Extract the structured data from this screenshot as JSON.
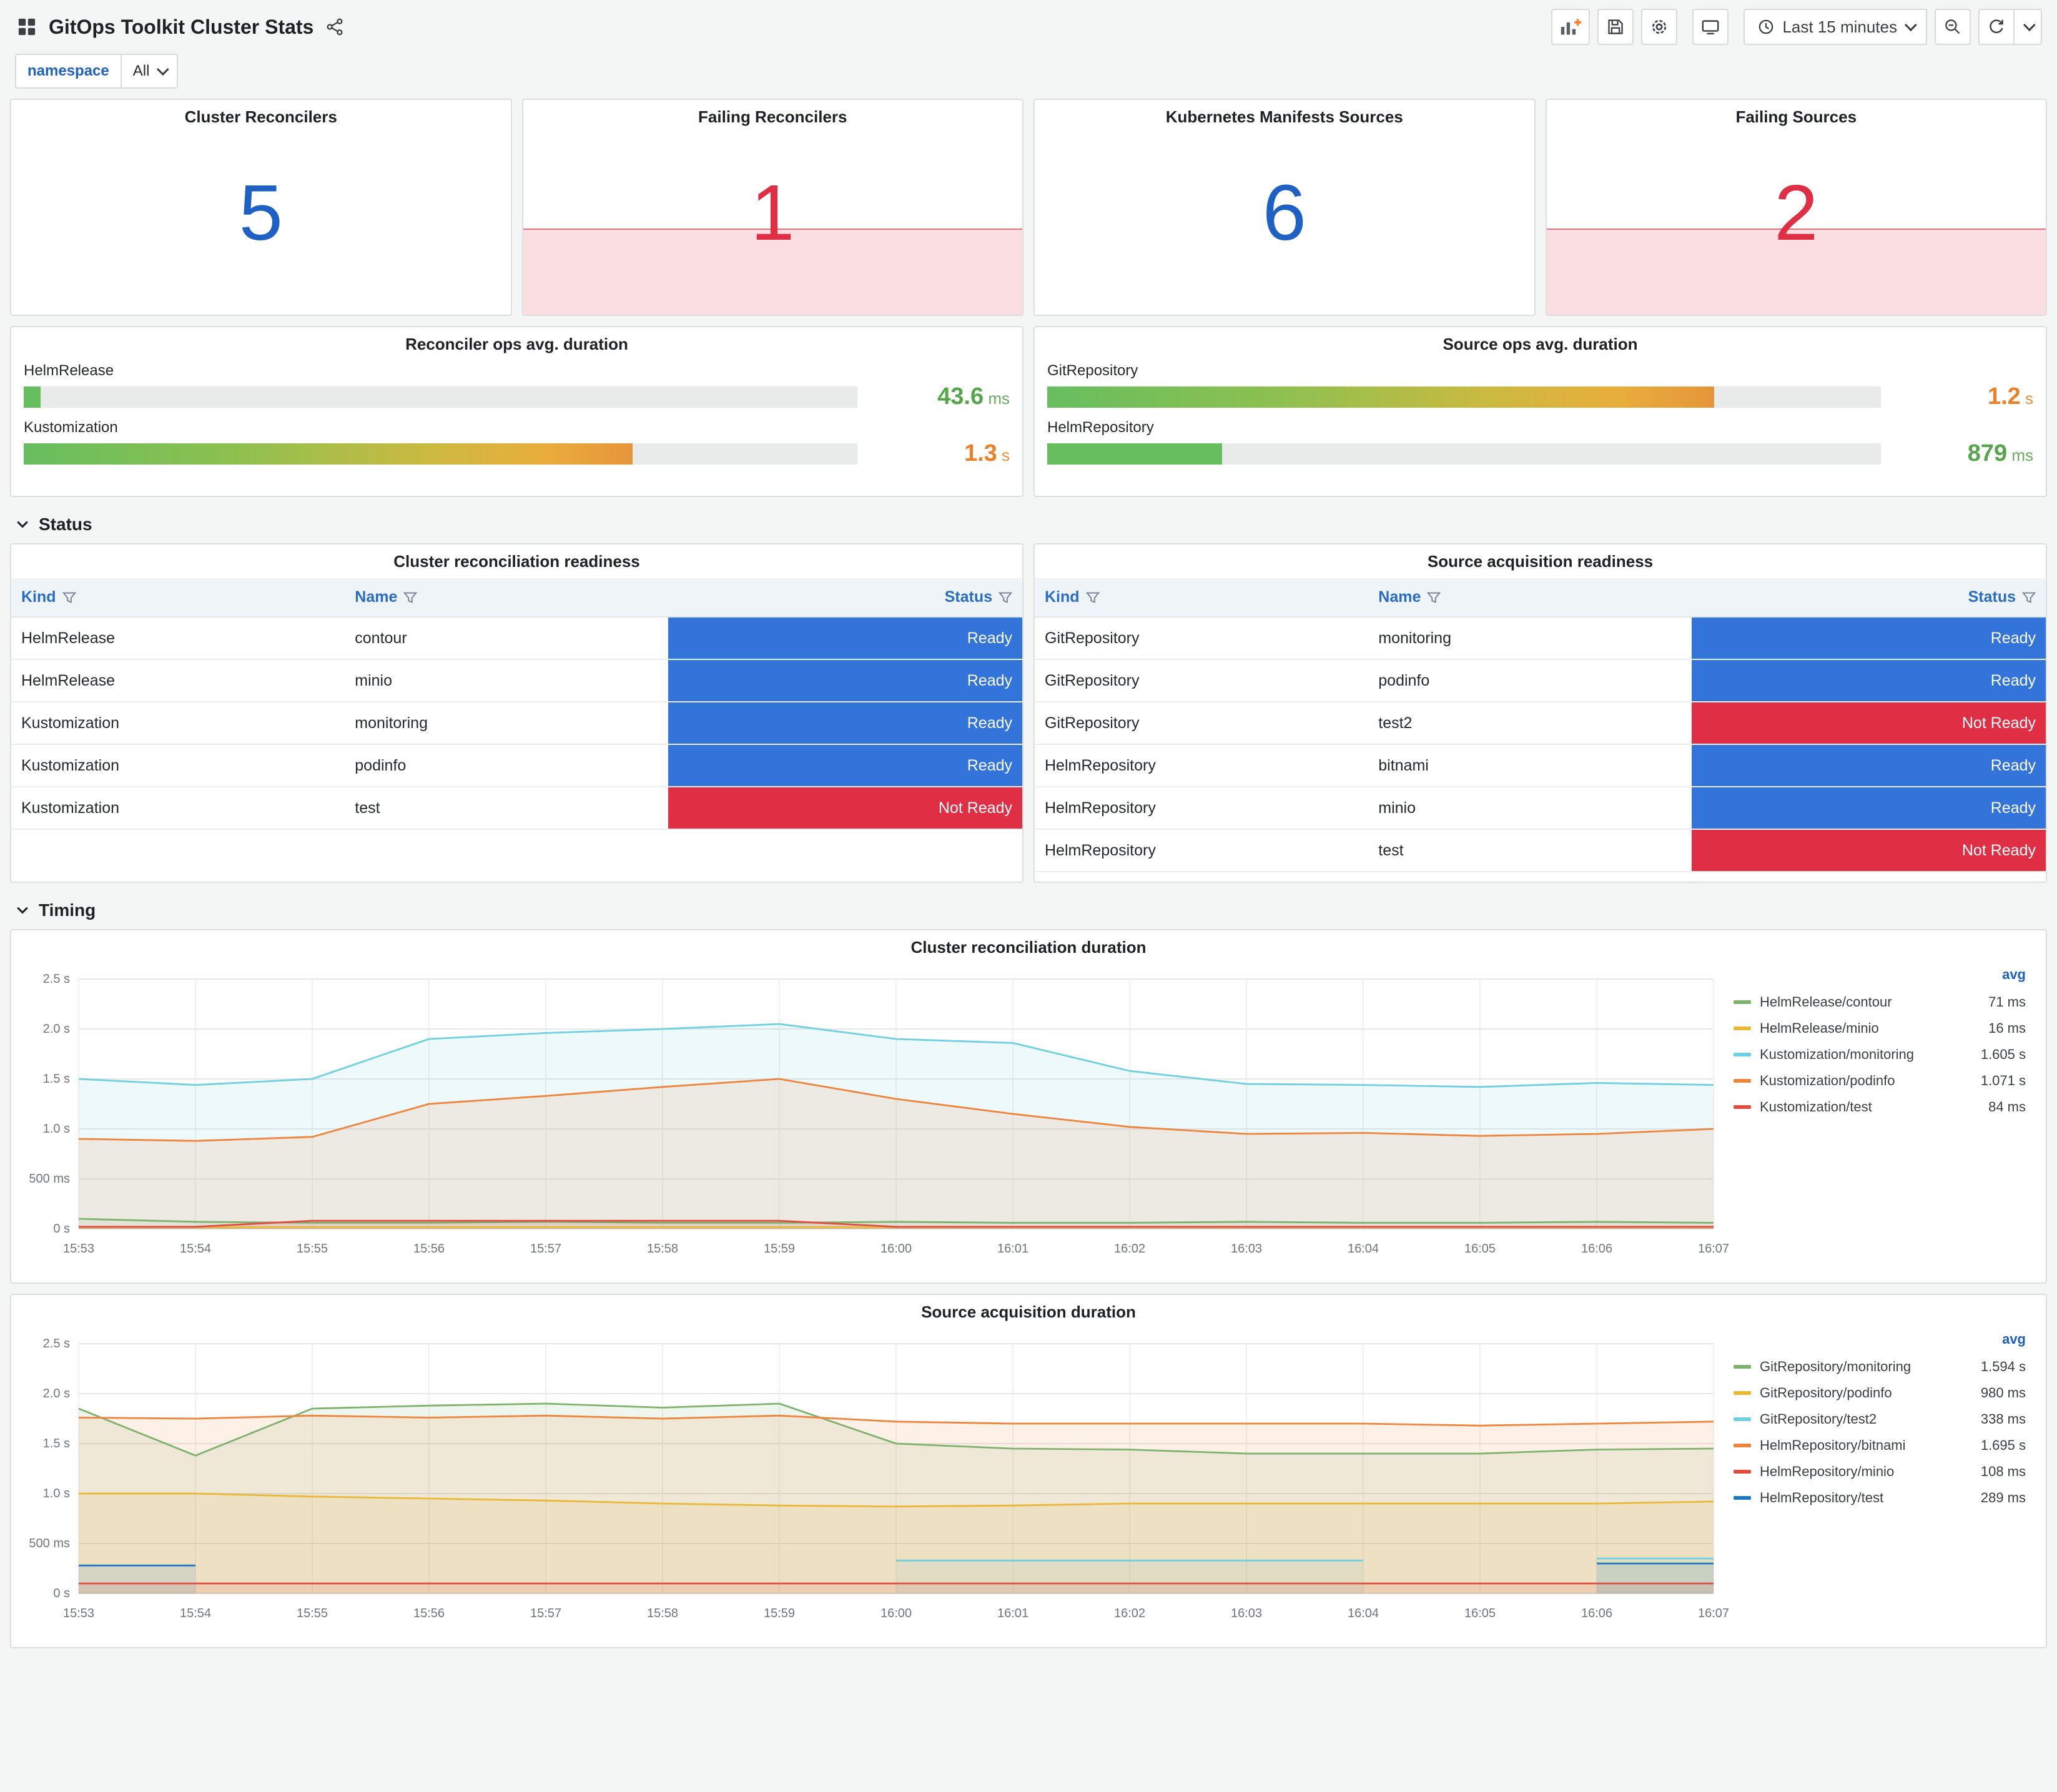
{
  "header": {
    "title": "GitOps Toolkit Cluster Stats",
    "time_range": "Last 15 minutes"
  },
  "toolbar": {
    "icons": [
      "add-panel",
      "save-dashboard",
      "dashboard-settings",
      "cycle-view-mode",
      "time-picker",
      "zoom-out",
      "refresh",
      "refresh-interval"
    ]
  },
  "variables": {
    "name": "namespace",
    "value": "All"
  },
  "stats": [
    {
      "title": "Cluster Reconcilers",
      "value": "5",
      "color": "#1F60C4",
      "failing": false
    },
    {
      "title": "Failing Reconcilers",
      "value": "1",
      "color": "#E02F44",
      "failing": true
    },
    {
      "title": "Kubernetes Manifests Sources",
      "value": "6",
      "color": "#1F60C4",
      "failing": false
    },
    {
      "title": "Failing Sources",
      "value": "2",
      "color": "#E02F44",
      "failing": true
    }
  ],
  "duration_panels": [
    {
      "title": "Reconciler ops avg. duration",
      "rows": [
        {
          "label": "HelmRelease",
          "value": "43.6",
          "unit": "ms",
          "pct": 2,
          "value_color": "#56A64B",
          "bar": "bar-green"
        },
        {
          "label": "Kustomization",
          "value": "1.3",
          "unit": "s",
          "pct": 73,
          "value_color": "#ED8128",
          "bar": "bar-gradient"
        }
      ]
    },
    {
      "title": "Source ops avg. duration",
      "rows": [
        {
          "label": "GitRepository",
          "value": "1.2",
          "unit": "s",
          "pct": 80,
          "value_color": "#ED8128",
          "bar": "bar-gradient"
        },
        {
          "label": "HelmRepository",
          "value": "879",
          "unit": "ms",
          "pct": 21,
          "value_color": "#56A64B",
          "bar": "bar-green"
        }
      ]
    }
  ],
  "sections": {
    "status": "Status",
    "timing": "Timing"
  },
  "status_colors": {
    "Ready": "#3274D9",
    "Not Ready": "#E02F44"
  },
  "tables": [
    {
      "title": "Cluster reconciliation readiness",
      "columns": [
        "Kind",
        "Name",
        "Status"
      ],
      "rows": [
        [
          "HelmRelease",
          "contour",
          "Ready"
        ],
        [
          "HelmRelease",
          "minio",
          "Ready"
        ],
        [
          "Kustomization",
          "monitoring",
          "Ready"
        ],
        [
          "Kustomization",
          "podinfo",
          "Ready"
        ],
        [
          "Kustomization",
          "test",
          "Not Ready"
        ]
      ]
    },
    {
      "title": "Source acquisition readiness",
      "columns": [
        "Kind",
        "Name",
        "Status"
      ],
      "rows": [
        [
          "GitRepository",
          "monitoring",
          "Ready"
        ],
        [
          "GitRepository",
          "podinfo",
          "Ready"
        ],
        [
          "GitRepository",
          "test2",
          "Not Ready"
        ],
        [
          "HelmRepository",
          "bitnami",
          "Ready"
        ],
        [
          "HelmRepository",
          "minio",
          "Ready"
        ],
        [
          "HelmRepository",
          "test",
          "Not Ready"
        ]
      ]
    }
  ],
  "chart_data": [
    {
      "type": "line",
      "title": "Cluster reconciliation duration",
      "x": [
        "15:53",
        "15:54",
        "15:55",
        "15:56",
        "15:57",
        "15:58",
        "15:59",
        "16:00",
        "16:01",
        "16:02",
        "16:03",
        "16:04",
        "16:05",
        "16:06",
        "16:07"
      ],
      "ylim": [
        0,
        2.5
      ],
      "yticks": [
        {
          "v": 0,
          "label": "0 s"
        },
        {
          "v": 0.5,
          "label": "500 ms"
        },
        {
          "v": 1,
          "label": "1.0 s"
        },
        {
          "v": 1.5,
          "label": "1.5 s"
        },
        {
          "v": 2,
          "label": "2.0 s"
        },
        {
          "v": 2.5,
          "label": "2.5 s"
        }
      ],
      "legend_header": "avg",
      "legend_position": "right",
      "grid": true,
      "series": [
        {
          "name": "HelmRelease/contour",
          "avg": "71 ms",
          "color": "#7EB26D",
          "values": [
            0.1,
            0.07,
            0.06,
            0.06,
            0.07,
            0.06,
            0.06,
            0.07,
            0.06,
            0.06,
            0.07,
            0.06,
            0.06,
            0.07,
            0.06
          ]
        },
        {
          "name": "HelmRelease/minio",
          "avg": "16 ms",
          "color": "#EAB839",
          "values": [
            0.016,
            0.016,
            0.016,
            0.016,
            0.016,
            0.016,
            0.016,
            0.016,
            0.016,
            0.016,
            0.016,
            0.016,
            0.016,
            0.016,
            0.016
          ]
        },
        {
          "name": "Kustomization/monitoring",
          "avg": "1.605 s",
          "color": "#6ED0E0",
          "values": [
            1.5,
            1.44,
            1.5,
            1.9,
            1.96,
            2.0,
            2.05,
            1.9,
            1.86,
            1.58,
            1.45,
            1.44,
            1.42,
            1.46,
            1.44
          ]
        },
        {
          "name": "Kustomization/podinfo",
          "avg": "1.071 s",
          "color": "#EF843C",
          "values": [
            0.9,
            0.88,
            0.92,
            1.25,
            1.33,
            1.42,
            1.5,
            1.3,
            1.15,
            1.02,
            0.95,
            0.96,
            0.93,
            0.95,
            1.0
          ]
        },
        {
          "name": "Kustomization/test",
          "avg": "84 ms",
          "color": "#E24D42",
          "values": [
            0.02,
            0.02,
            0.08,
            0.08,
            0.08,
            0.08,
            0.08,
            0.02,
            0.02,
            0.02,
            0.02,
            0.02,
            0.02,
            0.02,
            0.02
          ]
        }
      ]
    },
    {
      "type": "line",
      "title": "Source acquisition duration",
      "x": [
        "15:53",
        "15:54",
        "15:55",
        "15:56",
        "15:57",
        "15:58",
        "15:59",
        "16:00",
        "16:01",
        "16:02",
        "16:03",
        "16:04",
        "16:05",
        "16:06",
        "16:07"
      ],
      "ylim": [
        0,
        2.5
      ],
      "yticks": [
        {
          "v": 0,
          "label": "0 s"
        },
        {
          "v": 0.5,
          "label": "500 ms"
        },
        {
          "v": 1,
          "label": "1.0 s"
        },
        {
          "v": 1.5,
          "label": "1.5 s"
        },
        {
          "v": 2,
          "label": "2.0 s"
        },
        {
          "v": 2.5,
          "label": "2.5 s"
        }
      ],
      "legend_header": "avg",
      "legend_position": "right",
      "grid": true,
      "series": [
        {
          "name": "GitRepository/monitoring",
          "avg": "1.594 s",
          "color": "#7EB26D",
          "values": [
            1.85,
            1.38,
            1.85,
            1.88,
            1.9,
            1.86,
            1.9,
            1.5,
            1.45,
            1.44,
            1.4,
            1.4,
            1.4,
            1.44,
            1.45
          ]
        },
        {
          "name": "GitRepository/podinfo",
          "avg": "980 ms",
          "color": "#EAB839",
          "values": [
            1.0,
            1.0,
            0.97,
            0.95,
            0.93,
            0.9,
            0.88,
            0.87,
            0.88,
            0.9,
            0.9,
            0.9,
            0.9,
            0.9,
            0.92
          ]
        },
        {
          "name": "GitRepository/test2",
          "avg": "338 ms",
          "color": "#6ED0E0",
          "values": [
            null,
            null,
            null,
            null,
            null,
            null,
            null,
            0.33,
            0.33,
            0.33,
            0.33,
            0.33,
            null,
            0.35,
            0.35
          ]
        },
        {
          "name": "HelmRepository/bitnami",
          "avg": "1.695 s",
          "color": "#EF843C",
          "values": [
            1.76,
            1.75,
            1.78,
            1.76,
            1.78,
            1.75,
            1.78,
            1.72,
            1.7,
            1.7,
            1.7,
            1.7,
            1.68,
            1.7,
            1.72
          ]
        },
        {
          "name": "HelmRepository/minio",
          "avg": "108 ms",
          "color": "#E24D42",
          "values": [
            0.1,
            0.1,
            0.1,
            0.1,
            0.1,
            0.1,
            0.1,
            0.1,
            0.1,
            0.1,
            0.1,
            0.1,
            0.1,
            0.1,
            0.1
          ]
        },
        {
          "name": "HelmRepository/test",
          "avg": "289 ms",
          "color": "#1F78C1",
          "values": [
            0.28,
            0.28,
            null,
            null,
            null,
            null,
            null,
            null,
            null,
            null,
            null,
            null,
            null,
            0.3,
            0.3
          ]
        }
      ]
    }
  ]
}
